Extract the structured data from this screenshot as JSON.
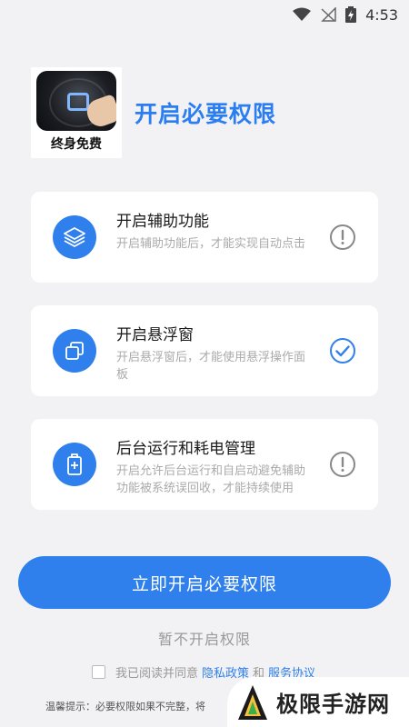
{
  "status_bar": {
    "time": "4:53"
  },
  "header": {
    "logo_text": "终身免费",
    "title": "开启必要权限"
  },
  "permissions": [
    {
      "title": "开启辅助功能",
      "desc": "开启辅助功能后，才能实现自动点击",
      "icon": "layers-icon",
      "status": "warning"
    },
    {
      "title": "开启悬浮窗",
      "desc": "开启悬浮窗后，才能使用悬浮操作面板",
      "icon": "floating-window-icon",
      "status": "granted"
    },
    {
      "title": "后台运行和耗电管理",
      "desc": "开启允许后台运行和自启动避免辅助功能被系统误回收，才能持续使用",
      "icon": "battery-icon",
      "status": "warning"
    }
  ],
  "primary_button": "立即开启必要权限",
  "skip_link": "暂不开启权限",
  "agreement": {
    "prefix": "我已阅读并同意",
    "privacy": "隐私政策",
    "and": "和",
    "terms": "服务协议"
  },
  "tip": "温馨提示：必要权限如果不完整，将",
  "watermark": "极限手游网",
  "colors": {
    "accent": "#2f80ed",
    "title": "#2b7df2",
    "background": "#f2f2f4"
  }
}
